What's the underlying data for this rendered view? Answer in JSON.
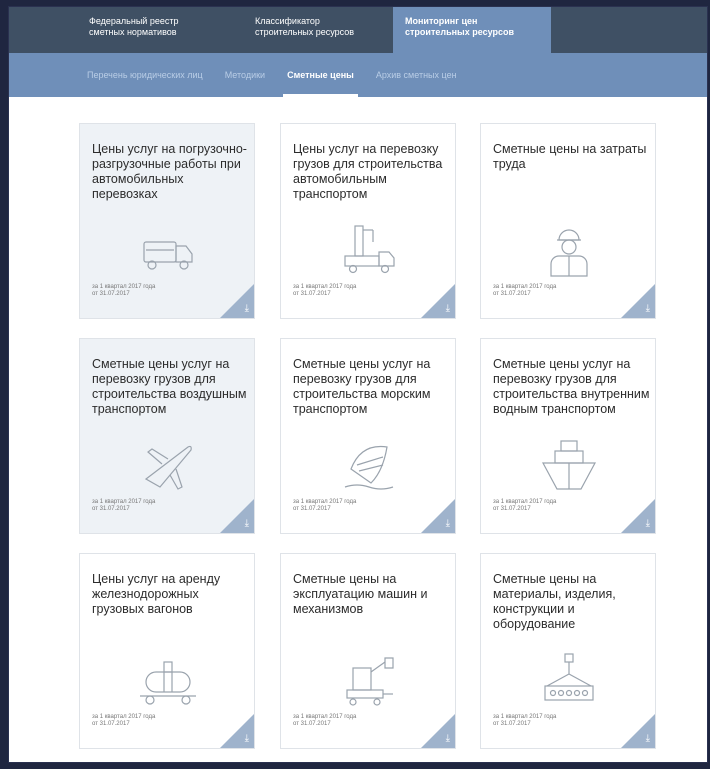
{
  "topnav": [
    {
      "line1": "Федеральный реестр",
      "line2": "сметных нормативов"
    },
    {
      "line1": "Классификатор",
      "line2": "строительных ресурсов"
    },
    {
      "line1": "Мониторинг цен",
      "line2": "строительных ресурсов"
    }
  ],
  "subnav": [
    "Перечень юридических лиц",
    "Методики",
    "Сметные цены",
    "Архив сметных цен"
  ],
  "cards": [
    {
      "title": "Цены услуг на погрузочно-разгрузочные работы при автомобильных перевозках",
      "date1": "за 1 квартал 2017 года",
      "date2": "от 31.07.2017",
      "icon": "truck-icon"
    },
    {
      "title": "Цены услуг на перевозку грузов для строительства автомобильным транспортом",
      "date1": "за 1 квартал 2017 года",
      "date2": "от 31.07.2017",
      "icon": "crane-truck-icon"
    },
    {
      "title": "Сметные цены на затраты труда",
      "date1": "за 1 квартал 2017 года",
      "date2": "от 31.07.2017",
      "icon": "worker-icon"
    },
    {
      "title": "Сметные цены услуг на перевозку грузов для строительства воздушным транспортом",
      "date1": "за 1 квартал 2017 года",
      "date2": "от 31.07.2017",
      "icon": "airplane-icon"
    },
    {
      "title": "Сметные цены услуг на перевозку грузов для строительства морским транспортом",
      "date1": "за 1 квартал 2017 года",
      "date2": "от 31.07.2017",
      "icon": "sea-ship-icon"
    },
    {
      "title": "Сметные цены услуг на перевозку грузов для строительства внутренним водным транспортом",
      "date1": "за 1 квартал 2017 года",
      "date2": "от 31.07.2017",
      "icon": "river-ship-icon"
    },
    {
      "title": "Цены услуг на аренду железнодорожных грузовых вагонов",
      "date1": "за 1 квартал 2017 года",
      "date2": "от 31.07.2017",
      "icon": "rail-tank-car-icon"
    },
    {
      "title": "Сметные цены на эксплуатацию машин и механизмов",
      "date1": "за 1 квартал 2017 года",
      "date2": "от 31.07.2017",
      "icon": "excavator-icon"
    },
    {
      "title": "Сметные цены на материалы, изделия, конструкции и оборудование",
      "date1": "за 1 квартал 2017 года",
      "date2": "от 31.07.2017",
      "icon": "crane-load-icon"
    }
  ],
  "download_arrow": "⤓",
  "colors": {
    "topnav": "#3f5064",
    "accent": "#6f8fb9",
    "download": "#9fb3cc"
  }
}
